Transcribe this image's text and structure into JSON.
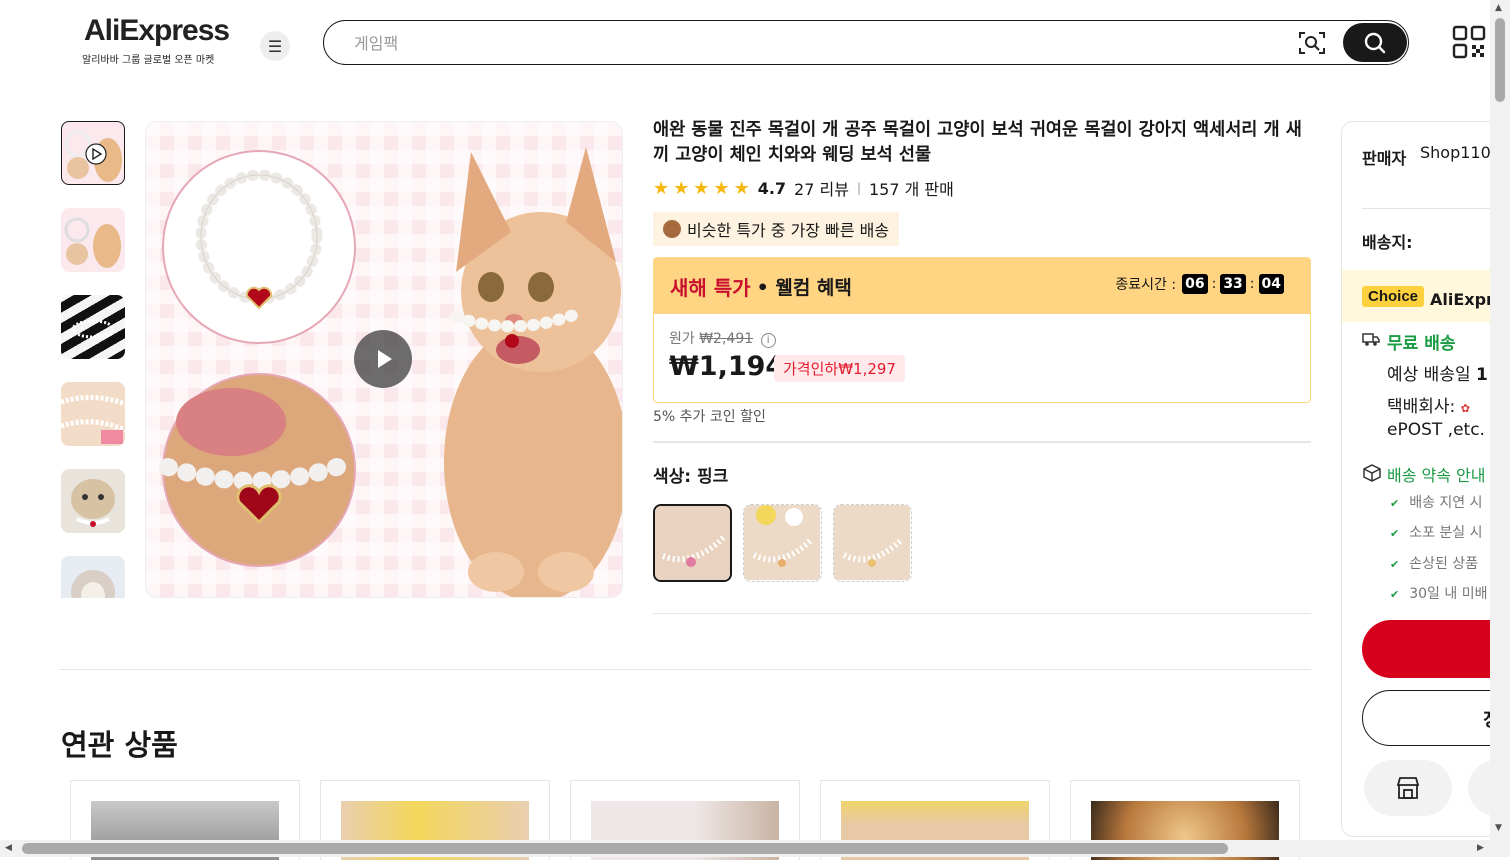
{
  "header": {
    "logo": "AliExpress",
    "logo_sub": "알리바바 그룹 글로벌 오픈 마켓",
    "search_placeholder": "게임팩"
  },
  "product": {
    "title": "애완 동물 진주 목걸이 개 공주 목걸이 고양이 보석 귀여운 목걸이 강아지 액세서리 개 새끼 고양이 체인 치와와 웨딩 보석 선물",
    "rating": "4.7",
    "reviews": "27 리뷰",
    "sold": "157 개 판매",
    "fast_badge": "비슷한 특가 중 가장 빠른 배송",
    "deal_title": "새해 특가",
    "deal_sub": "• 웰컴 혜택",
    "timer_label": "종료시간 :",
    "timer": [
      "06",
      "33",
      "04"
    ],
    "orig_label": "원가",
    "orig_price": "₩2,491",
    "price": "₩1,194",
    "discount": "가격인하₩1,297",
    "coin_note": "5% 추가 코인 할인",
    "color_label": "색상: 핑크"
  },
  "related": {
    "title": "연관 상품"
  },
  "side_panel": {
    "seller_label": "판매자",
    "seller_name": "Shop110",
    "ship_to": "배송지:",
    "choice": "Choice",
    "choice_brand": "AliExpr",
    "free_ship": "무료 배송",
    "est_delivery": "예상 배송일",
    "est_delivery_val": "1",
    "courier": "택배회사:",
    "courier_names": "ePOST ,etc.",
    "promise": "배송 약속 안내",
    "promise_items": [
      "배송 지연 시",
      "소포 분실 시",
      "손상된 상품",
      "30일 내 미배"
    ],
    "cart_label": "징"
  },
  "colors": {
    "accent_red": "#d6001c",
    "deal_header": "#ffd482",
    "choice_yellow": "#fdd13d",
    "green": "#1a9b44"
  }
}
